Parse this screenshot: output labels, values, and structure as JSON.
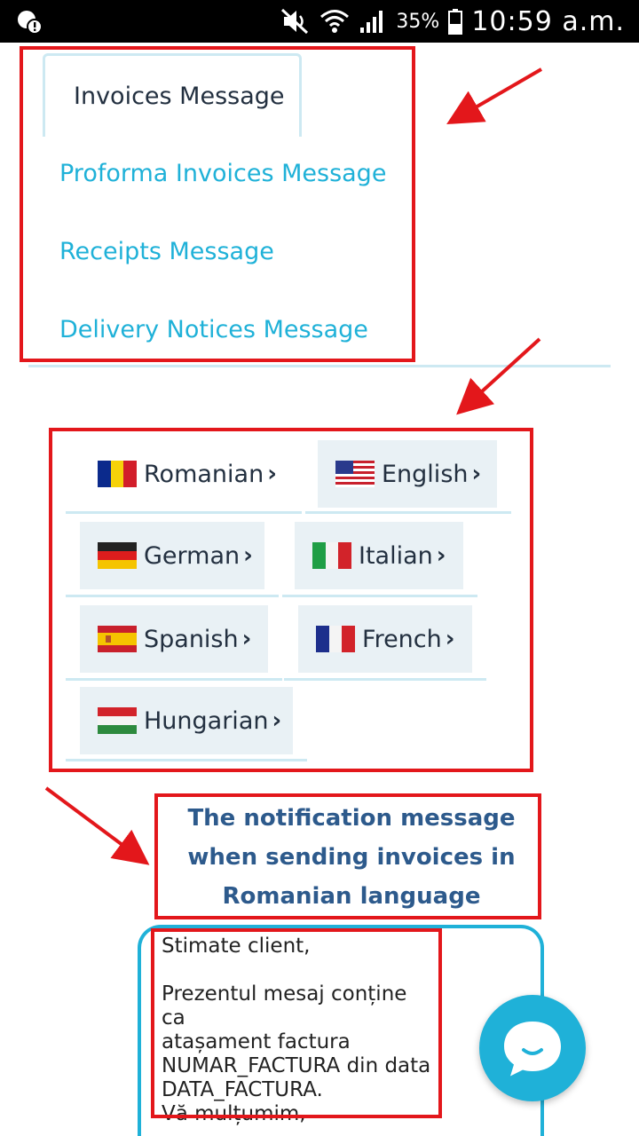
{
  "status_bar": {
    "battery_percent": "35%",
    "time": "10:59 a.m.",
    "icons": [
      "alert-icon",
      "mute-icon",
      "wifi-icon",
      "signal-icon",
      "battery-icon"
    ]
  },
  "tabs": {
    "active": "Invoices Message",
    "links": [
      "Proforma Invoices Message",
      "Receipts Message",
      "Delivery Notices Message"
    ]
  },
  "languages": [
    {
      "label": "Romanian",
      "chevron": "›",
      "flag": "romania-flag-icon",
      "selected": true
    },
    {
      "label": "English",
      "chevron": "›",
      "flag": "usa-flag-icon",
      "selected": false
    },
    {
      "label": "German",
      "chevron": "›",
      "flag": "germany-flag-icon",
      "selected": false
    },
    {
      "label": "Italian",
      "chevron": "›",
      "flag": "italy-flag-icon",
      "selected": false
    },
    {
      "label": "Spanish",
      "chevron": "›",
      "flag": "spain-flag-icon",
      "selected": false
    },
    {
      "label": "French",
      "chevron": "›",
      "flag": "france-flag-icon",
      "selected": false
    },
    {
      "label": "Hungarian",
      "chevron": "›",
      "flag": "hungary-flag-icon",
      "selected": false
    }
  ],
  "notification": {
    "title": "The notification message when sending invoices in Romanian language"
  },
  "message": {
    "greeting": "Stimate client,",
    "body_line1": "Prezentul mesaj conține ca",
    "body_line2": "atașament factura",
    "body_line3": "NUMAR_FACTURA din data",
    "body_line4": "DATA_FACTURA.",
    "closing": "Vă mulțumim,"
  },
  "colors": {
    "accent": "#1fb1d8",
    "annotation_red": "#e3171b",
    "title_blue": "#2d5a8c",
    "tab_border": "#cde9f2",
    "lang_button_bg": "#e9f1f5"
  }
}
